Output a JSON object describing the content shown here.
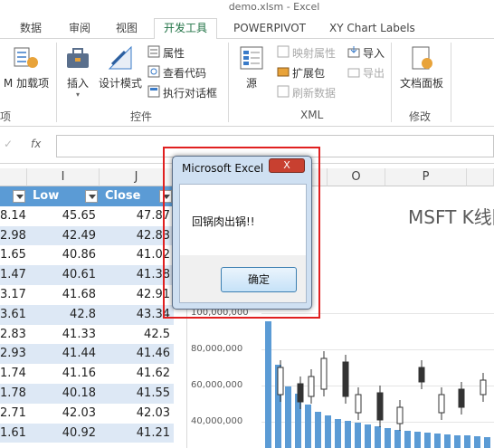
{
  "window": {
    "title": "demo.xlsm - Excel"
  },
  "tabs": [
    {
      "label": "数据"
    },
    {
      "label": "审阅"
    },
    {
      "label": "视图"
    },
    {
      "label": "开发工具",
      "active": true
    },
    {
      "label": "POWERPIVOT"
    },
    {
      "label": "XY Chart Labels"
    }
  ],
  "ribbon": {
    "addins": {
      "m_addin": "M 加载项",
      "group_label": "项"
    },
    "controls": {
      "insert": "插入",
      "design_mode": "设计模式",
      "properties": "属性",
      "view_code": "查看代码",
      "run_dialog": "执行对话框",
      "group_label": "控件"
    },
    "xml": {
      "source": "源",
      "map_properties": "映射属性",
      "expansion_packs": "扩展包",
      "refresh_data": "刷新数据",
      "import": "导入",
      "export": "导出",
      "group_label": "XML"
    },
    "modify": {
      "document_panel": "文档面板",
      "group_label": "修改"
    }
  },
  "formula_bar": {
    "fx": "fx",
    "check": "✓"
  },
  "columns": [
    "I",
    "J",
    "O",
    "P"
  ],
  "table": {
    "headers": [
      "Low",
      "Close"
    ],
    "rows": [
      [
        "8.14",
        "45.65",
        "47.87"
      ],
      [
        "2.98",
        "42.49",
        "42.83"
      ],
      [
        "1.65",
        "40.86",
        "41.02"
      ],
      [
        "1.47",
        "40.61",
        "41.38"
      ],
      [
        "3.17",
        "41.68",
        "42.91"
      ],
      [
        "3.61",
        "42.8",
        "43.34"
      ],
      [
        "2.83",
        "41.33",
        "42.5"
      ],
      [
        "2.93",
        "41.44",
        "41.46"
      ],
      [
        "1.74",
        "41.16",
        "41.62"
      ],
      [
        "1.78",
        "40.18",
        "41.55"
      ],
      [
        "2.71",
        "42.03",
        "42.03"
      ],
      [
        "1.61",
        "40.92",
        "41.21"
      ]
    ]
  },
  "chart": {
    "title": "MSFT K线图",
    "y_labels": [
      "100,000,000",
      "80,000,000",
      "60,000,000",
      "40,000,000"
    ]
  },
  "dialog": {
    "title": "Microsoft Excel",
    "close": "X",
    "message": "回锅肉出锅!!",
    "ok_label": "确定"
  },
  "colors": {
    "accent": "#217346",
    "table_header": "#5b9bd5",
    "table_band": "#dde8f5",
    "bar": "#5b9bd5",
    "highlight": "#e02020"
  }
}
